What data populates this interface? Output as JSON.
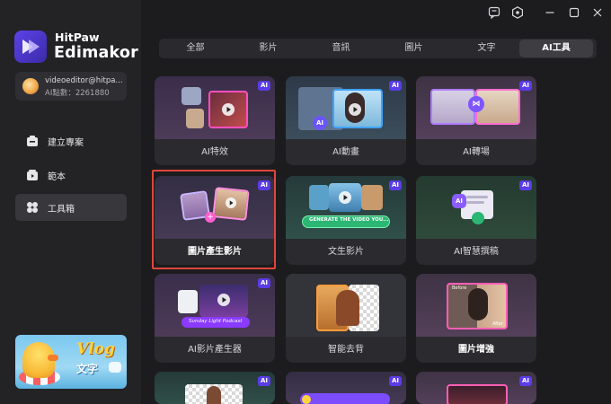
{
  "app": {
    "brand_top": "HitPaw",
    "brand_main": "Edimakor",
    "accent": "#5a3de8"
  },
  "account": {
    "email": "videoeditor@hitpa...",
    "points": "AI點數：2261880"
  },
  "sidebar": {
    "items": [
      {
        "label": "建立專案",
        "icon": "new-project-icon"
      },
      {
        "label": "範本",
        "icon": "template-icon"
      },
      {
        "label": "工具箱",
        "icon": "toolbox-icon",
        "active": true
      }
    ],
    "banner": {
      "title": "Vlog",
      "subtitle": "文字"
    }
  },
  "window": {
    "buttons": [
      "feedback-icon",
      "settings-icon",
      "minimize-icon",
      "maximize-icon",
      "close-icon"
    ]
  },
  "tabs": [
    {
      "label": "全部"
    },
    {
      "label": "影片"
    },
    {
      "label": "音訊"
    },
    {
      "label": "圖片"
    },
    {
      "label": "文字"
    },
    {
      "label": "AI工具",
      "active": true
    }
  ],
  "badge": "AI",
  "cards": [
    {
      "label": "AI特效"
    },
    {
      "label": "AI動畫"
    },
    {
      "label": "AI轉場"
    },
    {
      "label": "圖片產生影片",
      "highlighted": true
    },
    {
      "label": "文生影片",
      "thumb_text": "GENERATE THE VIDEO YOU..."
    },
    {
      "label": "AI智慧撰稿"
    },
    {
      "label": "AI影片產生器",
      "thumb_text": "Sunday Light Podcast"
    },
    {
      "label": "智能去背"
    },
    {
      "label": "圖片增強",
      "thumb_before": "Before",
      "thumb_after": "After"
    }
  ]
}
